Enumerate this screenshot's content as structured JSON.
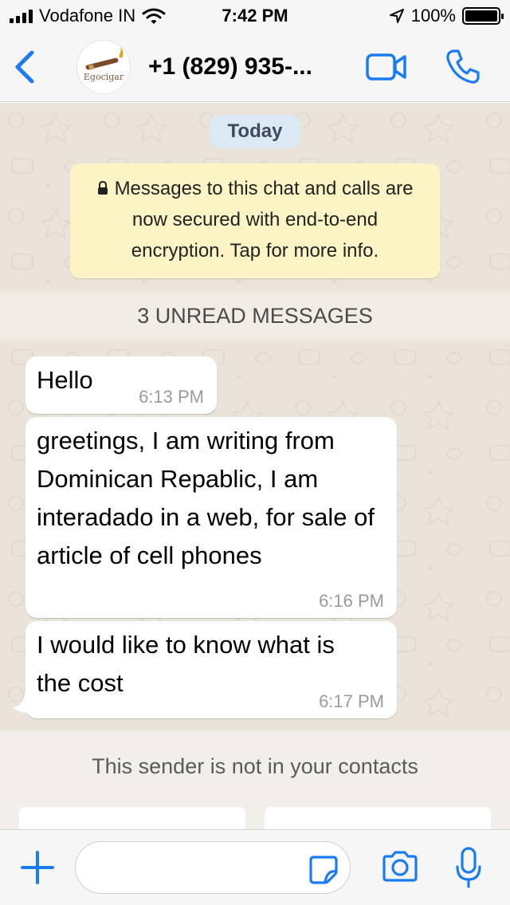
{
  "status_bar": {
    "carrier": "Vodafone IN",
    "time": "7:42 PM",
    "battery": "100%"
  },
  "header": {
    "avatar_brand": "Egocigar",
    "contact_name": "+1 (829) 935-...",
    "icons": {
      "back": "chevron-left-icon",
      "video": "video-camera-icon",
      "call": "phone-icon"
    },
    "accent_color": "#1a7cf4"
  },
  "chat": {
    "date_label": "Today",
    "encryption_notice": "Messages to this chat and calls are now secured with end-to-end encryption. Tap for more info.",
    "unread_label": "3 UNREAD MESSAGES",
    "messages": [
      {
        "text": "Hello",
        "time": "6:13 PM"
      },
      {
        "text": "greetings, I am writing from Dominican Repablic, I am interadado in a web, for sale of article of cell phones",
        "time": "6:16 PM"
      },
      {
        "text": "I would like to know what is the cost",
        "time": "6:17 PM"
      }
    ]
  },
  "sender_notice": "This sender is not in your contacts",
  "input_bar": {
    "message_value": "",
    "icons": {
      "attach": "plus-icon",
      "sticker": "sticker-icon",
      "camera": "camera-icon",
      "mic": "microphone-icon"
    }
  }
}
